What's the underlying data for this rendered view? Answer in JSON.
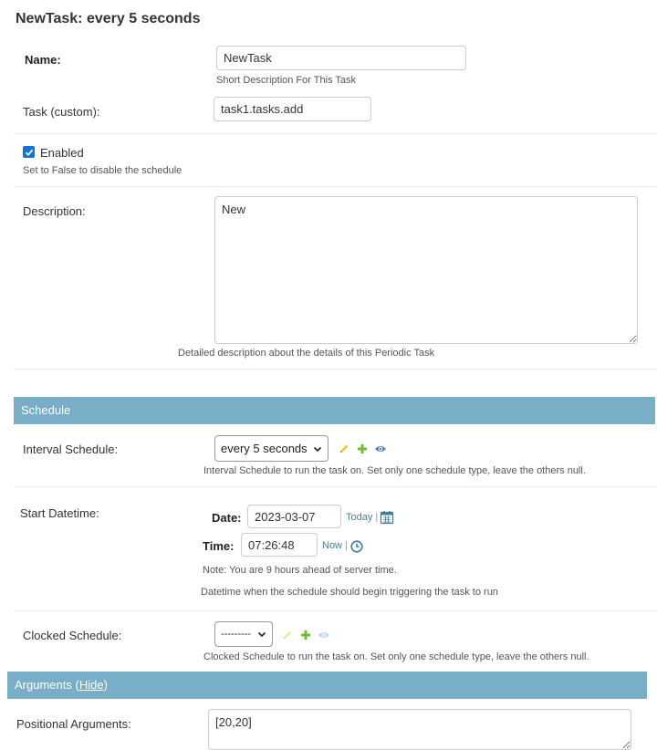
{
  "page_title": "NewTask: every 5 seconds",
  "name_field": {
    "label": "Name:",
    "value": "NewTask",
    "help": "Short Description For This Task"
  },
  "task_field": {
    "label": "Task (custom):",
    "value": "task1.tasks.add"
  },
  "enabled_field": {
    "label": "Enabled",
    "checked": true,
    "help": "Set to False to disable the schedule"
  },
  "description_field": {
    "label": "Description:",
    "value": "New",
    "help": "Detailed description about the details of this Periodic Task"
  },
  "schedule_section": {
    "title": "Schedule"
  },
  "interval_field": {
    "label": "Interval Schedule:",
    "selected": "every 5 seconds",
    "help": "Interval Schedule to run the task on. Set only one schedule type, leave the others null."
  },
  "start_datetime": {
    "label": "Start Datetime:",
    "date_label": "Date:",
    "date_value": "2023-03-07",
    "today_link": "Today",
    "sep": "|",
    "time_label": "Time:",
    "time_value": "07:26:48",
    "now_link": "Now",
    "note": "Note: You are 9 hours ahead of server time.",
    "help": "Datetime when the schedule should begin triggering the task to run"
  },
  "clocked_field": {
    "label": "Clocked Schedule:",
    "selected": "---------",
    "help": "Clocked Schedule to run the task on. Set only one schedule type, leave the others null."
  },
  "arguments_section": {
    "title": "Arguments (",
    "toggle": "Hide",
    "close": ")"
  },
  "positional_args": {
    "label": "Positional Arguments:",
    "value": "[20,20]"
  },
  "colors": {
    "section_bar": "#79aec8",
    "link": "#447e9b",
    "edit_icon": "#f2c531",
    "add_icon": "#70bf2b",
    "view_icon": "#417ec4"
  }
}
